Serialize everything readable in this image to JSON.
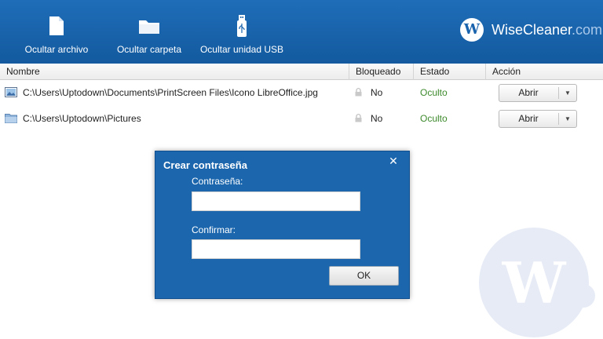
{
  "toolbar": {
    "hide_file_label": "Ocultar archivo",
    "hide_folder_label": "Ocultar carpeta",
    "hide_usb_label": "Ocultar unidad USB"
  },
  "brand": {
    "logo_letter": "W",
    "name": "WiseCleaner",
    "suffix": ".com"
  },
  "table": {
    "columns": [
      "Nombre",
      "Bloqueado",
      "Estado",
      "Acción"
    ],
    "rows": [
      {
        "type": "image-file-icon",
        "path": "C:\\Users\\Uptodown\\Documents\\PrintScreen Files\\Icono LibreOffice.jpg",
        "locked": "No",
        "state": "Oculto",
        "action": "Abrir"
      },
      {
        "type": "folder-icon",
        "path": "C:\\Users\\Uptodown\\Pictures",
        "locked": "No",
        "state": "Oculto",
        "action": "Abrir"
      }
    ]
  },
  "dialog": {
    "title": "Crear contraseña",
    "close_glyph": "✕",
    "password_label": "Contraseña:",
    "confirm_label": "Confirmar:",
    "ok_label": "OK"
  },
  "watermark": {
    "letter": "W"
  },
  "colors": {
    "toolbar_blue": "#1a63ad",
    "state_green": "#3d8a2c",
    "dialog_blue": "#1b66ad"
  }
}
